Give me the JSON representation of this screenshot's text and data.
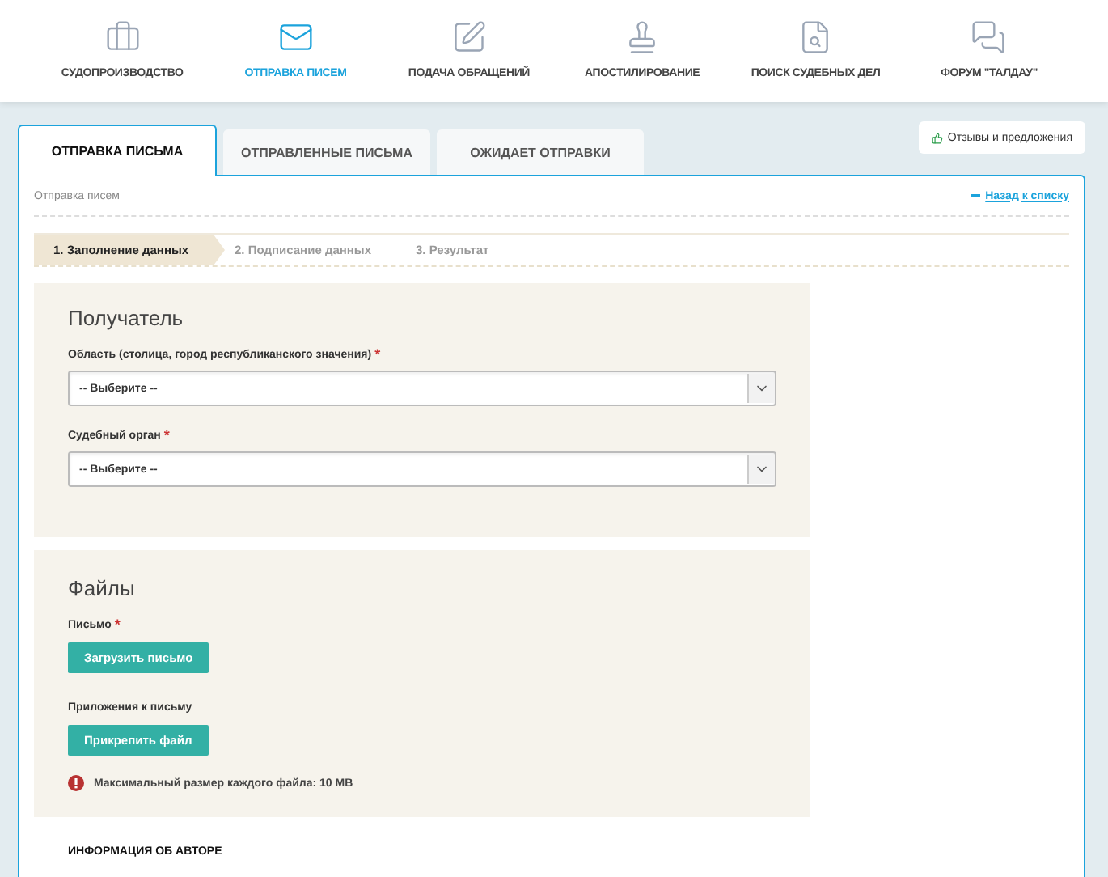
{
  "nav": [
    {
      "label": "СУДОПРОИЗВОДСТВО",
      "selected": false
    },
    {
      "label": "ОТПРАВКА ПИСЕМ",
      "selected": true
    },
    {
      "label": "ПОДАЧА ОБРАЩЕНИЙ",
      "selected": false
    },
    {
      "label": "АПОСТИЛИРОВАНИЕ",
      "selected": false
    },
    {
      "label": "ПОИСК СУДЕБНЫХ ДЕЛ",
      "selected": false
    },
    {
      "label": "ФОРУМ \"ТАЛДАУ\"",
      "selected": false
    }
  ],
  "tabs": [
    {
      "label": "ОТПРАВКА ПИСЬМА",
      "selected": true
    },
    {
      "label": "ОТПРАВЛЕННЫЕ ПИСЬМА",
      "selected": false
    },
    {
      "label": "ОЖИДАЕТ ОТПРАВКИ",
      "selected": false
    }
  ],
  "feedback_button": "Отзывы и предложения",
  "breadcrumb": "Отправка писем",
  "back_link": "Назад к списку",
  "steps": [
    {
      "label": "1. Заполнение данных",
      "selected": true
    },
    {
      "label": "2. Подписание данных",
      "selected": false
    },
    {
      "label": "3. Результат",
      "selected": false
    }
  ],
  "recipient": {
    "title": "Получатель",
    "fields": [
      {
        "label": "Область (столица, город республиканского значения)",
        "required_mark": "*",
        "value": "-- Выберите --"
      },
      {
        "label": "Судебный орган",
        "required_mark": "*",
        "value": "-- Выберите --"
      }
    ]
  },
  "files": {
    "title": "Файлы",
    "groups": [
      {
        "label": "Письмо",
        "required_mark": "*",
        "button": "Загрузить письмо"
      },
      {
        "label": "Приложения к письму",
        "button": "Прикрепить файл"
      }
    ],
    "note": "Максимальный размер каждого файла: 10 MB"
  },
  "author_heading": "ИНФОРМАЦИЯ ОБ АВТОРЕ"
}
